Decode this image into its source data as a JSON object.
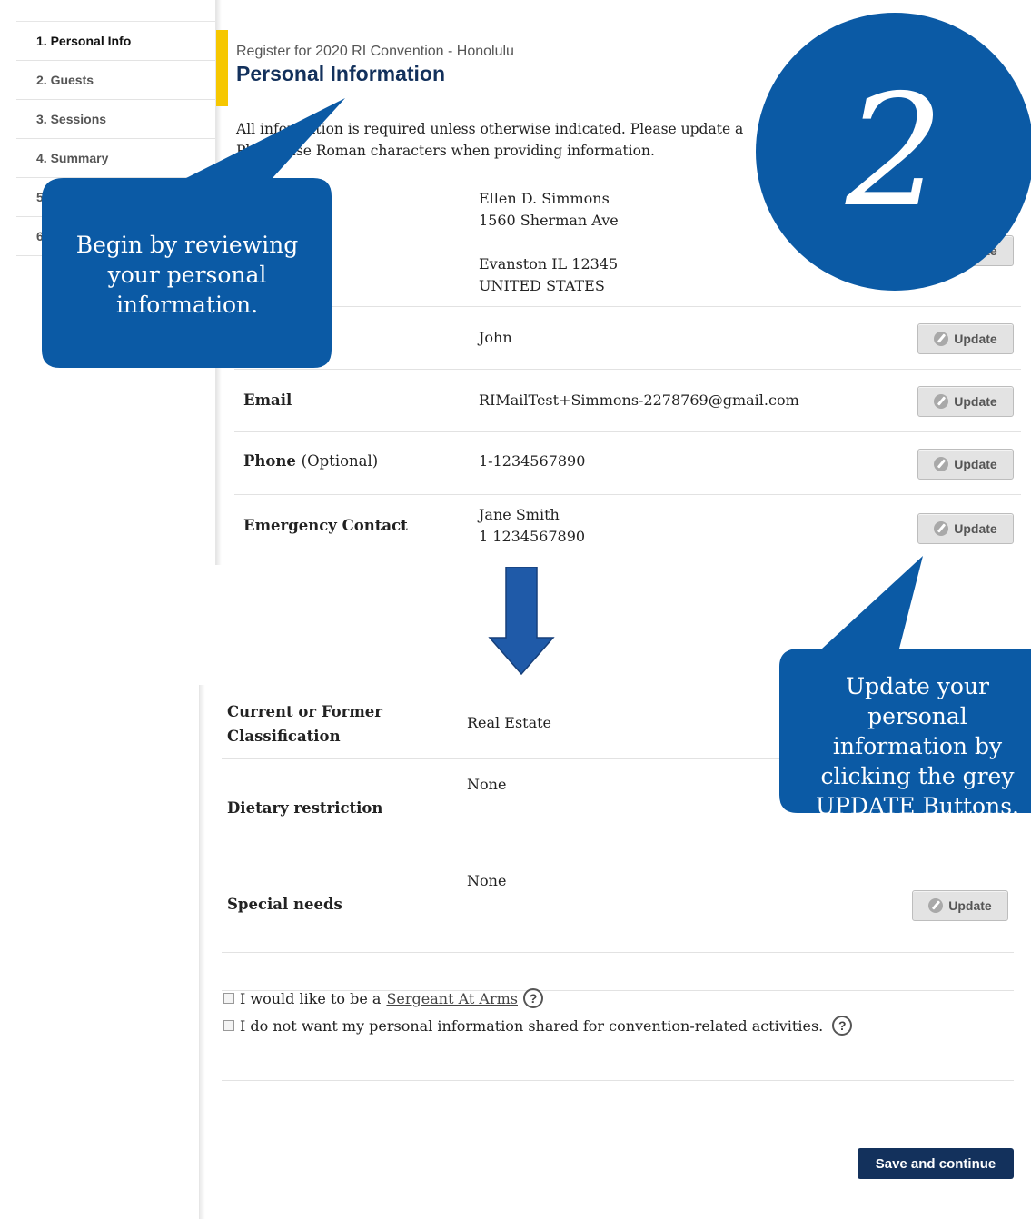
{
  "sidebar": {
    "items": [
      {
        "label": "1. Personal Info"
      },
      {
        "label": "2. Guests"
      },
      {
        "label": "3. Sessions"
      },
      {
        "label": "4. Summary"
      },
      {
        "label": "5"
      },
      {
        "label": "6"
      }
    ]
  },
  "header": {
    "breadcrumb": "Register for 2020 RI Convention - Honolulu",
    "title": "Personal Information",
    "intro_line1": "All information is required unless otherwise indicated. Please update a",
    "intro_line2": "Please use Roman characters when providing information."
  },
  "rows": {
    "address": {
      "line1": "Ellen D. Simmons",
      "line2": "1560 Sherman Ave",
      "line3": "Evanston IL 12345",
      "line4": "UNITED STATES"
    },
    "badge": {
      "value": "John"
    },
    "email": {
      "label": "Email",
      "value": "RIMailTest+Simmons-2278769@gmail.com"
    },
    "phone": {
      "label": "Phone",
      "optional": "(Optional)",
      "value": "1-1234567890"
    },
    "emergency": {
      "label": "Emergency Contact",
      "line1": "Jane Smith",
      "line2": "1 1234567890"
    },
    "update_label": "Update"
  },
  "bottom": {
    "classification": {
      "label_line1": "Current or Former",
      "label_line2": "Classification",
      "value": "Real Estate"
    },
    "dietary": {
      "label": "Dietary restriction",
      "value": "None"
    },
    "special": {
      "label": "Special needs",
      "value": "None"
    },
    "sergeant_text": "I would like to be a",
    "sergeant_link": "Sergeant At Arms",
    "share_text": "I do not want my personal information shared for convention-related activities.",
    "help_glyph": "?",
    "save_label": "Save and continue"
  },
  "callouts": {
    "step_number": "2",
    "review_line1": "Begin by reviewing",
    "review_line2": "your personal",
    "review_line3": "information.",
    "update_line1": "Update your",
    "update_line2": "personal",
    "update_line3": "information by",
    "update_line4": "clicking the grey",
    "update_line5": "UPDATE Buttons."
  },
  "colors": {
    "callout_blue": "#0b5aa5",
    "nav_navy": "#13315c",
    "accent_yellow": "#f6c700",
    "button_grey": "#e3e3e3"
  }
}
